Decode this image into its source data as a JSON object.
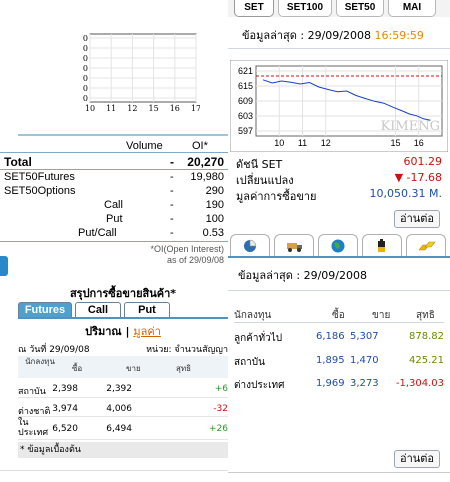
{
  "left_chart": {
    "y_ticks": [
      "0",
      "0",
      "0",
      "0",
      "0",
      "0",
      "0"
    ],
    "x_ticks": [
      "10",
      "11",
      "12",
      "15",
      "16",
      "17"
    ]
  },
  "oi_summary": {
    "header_volume": "Volume",
    "header_oi": "OI*",
    "rows": [
      {
        "label": "Total",
        "dash": "-",
        "value": "20,270"
      },
      {
        "label": "SET50Futures",
        "dash": "-",
        "value": "19,980"
      },
      {
        "label": "SET50Options",
        "dash": "-",
        "value": "290"
      },
      {
        "label": "Call",
        "dash": "-",
        "value": "190"
      },
      {
        "label": "Put",
        "dash": "-",
        "value": "100"
      },
      {
        "label": "Put/Call",
        "dash": "-",
        "value": "0.53"
      }
    ],
    "note_line1": "*OI(Open Interest)",
    "note_line2": "as of 29/09/08"
  },
  "trade_summary": {
    "title": "สรุปการซื้อขายสินค้า*",
    "tabs": [
      "Futures",
      "Call",
      "Put"
    ],
    "active_tab": "Futures",
    "subtitle": "ปริมาณ",
    "separator": "|",
    "more_link": "มูลค่า",
    "date": "ณ วันที่ 29/09/08",
    "unit": "หน่วย: จำนวนสัญญา",
    "columns": [
      "นักลงทุน",
      "ซื้อ",
      "ขาย",
      "สุทธิ"
    ],
    "rows": [
      {
        "investor": "สถาบัน",
        "buy": "2,398",
        "sell": "2,392",
        "net": "+6"
      },
      {
        "investor": "ต่างชาติ",
        "buy": "3,974",
        "sell": "4,006",
        "net": "-32"
      },
      {
        "investor": "ในประเทศ",
        "buy": "6,520",
        "sell": "6,494",
        "net": "+26"
      }
    ],
    "footnote": "* ข้อมูลเบื้องต้น",
    "colors": {
      "positive": "#2a9a2a",
      "negative": "#cc1111"
    }
  },
  "index_panel": {
    "tabs": [
      "SET",
      "SET100",
      "SET50",
      "MAI"
    ],
    "active_tab": "SET",
    "update_label": "ข้อมูลล่าสุด : 29/09/2008",
    "update_time": "16:59:59",
    "stats": [
      {
        "label": "ดัชนี SET",
        "value": "601.29"
      },
      {
        "label": "เปลี่ยนแปลง",
        "value": "▼ -17.68"
      },
      {
        "label": "มูลค่าการซื้อขาย",
        "value": "10,050.31 M."
      }
    ],
    "more_button": "อ่านต่อ"
  },
  "set_chart": {
    "type": "line",
    "y_tick_labels": [
      "621",
      "615",
      "609",
      "603",
      "597"
    ],
    "x_tick_labels": [
      "10",
      "11",
      "12",
      "15",
      "16"
    ],
    "reference_line": 619,
    "reference_color": "#cc1111",
    "series_color": "#1a3fc4",
    "watermark": "KIMENG",
    "ylim": [
      595,
      623
    ],
    "x": [
      9.3,
      9.7,
      10.1,
      10.5,
      10.9,
      11.3,
      11.7,
      12.1,
      12.5,
      12.9,
      13.3,
      13.7,
      14.1,
      14.5,
      14.9,
      15.3,
      15.6,
      15.9,
      16.2,
      16.5
    ],
    "values": [
      617.5,
      616.2,
      617.0,
      616.5,
      615.8,
      616.4,
      614.6,
      613.6,
      612.7,
      613.0,
      611.2,
      610.0,
      608.9,
      608.1,
      606.5,
      605.0,
      603.8,
      603.1,
      601.9,
      601.3
    ]
  },
  "investor_panel": {
    "icon_tabs": [
      "chart-pie-icon",
      "truck-icon",
      "globe-icon",
      "battery-icon",
      "gold-bars-icon"
    ],
    "update_label": "ข้อมูลล่าสุด : 29/09/2008",
    "columns": [
      "นักลงทุน",
      "ซื้อ",
      "ขาย",
      "สุทธิ"
    ],
    "rows": [
      {
        "investor": "ลูกค้าทั่วไป",
        "buy": "6,186",
        "sell": "5,307",
        "net": "878.82"
      },
      {
        "investor": "สถาบัน",
        "buy": "1,895",
        "sell": "1,470",
        "net": "425.21"
      },
      {
        "investor": "ต่างประเทศ",
        "buy": "1,969",
        "sell": "3,273",
        "net": "-1,304.03"
      }
    ],
    "more_button": "อ่านต่อ"
  }
}
